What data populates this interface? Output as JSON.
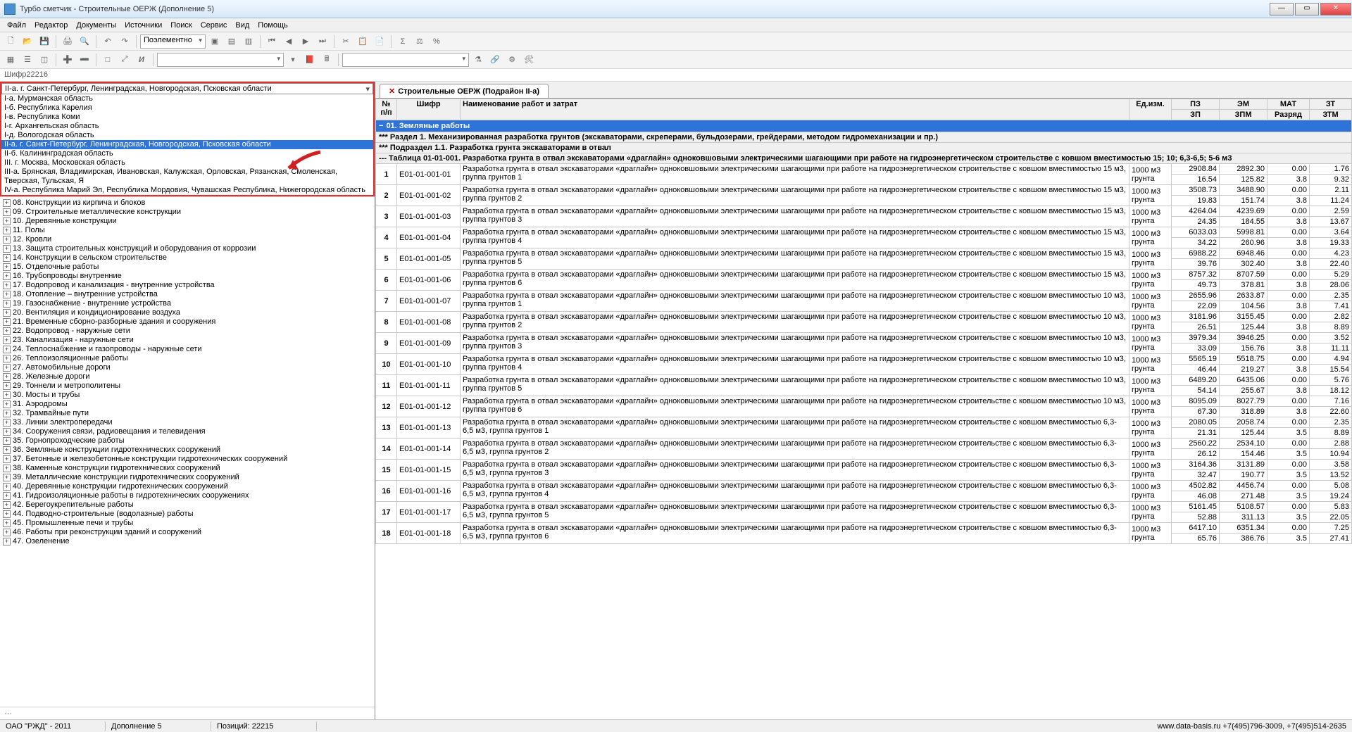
{
  "window": {
    "title": "Турбо сметчик - Строительные ОЕРЖ (Дополнение 5)"
  },
  "menu": [
    "Файл",
    "Редактор",
    "Документы",
    "Источники",
    "Поиск",
    "Сервис",
    "Вид",
    "Помощь"
  ],
  "toolbar2": {
    "combo": "Поэлементно"
  },
  "cipher": "Шифр22216",
  "region": {
    "current": "II-а. г. Санкт-Петербург, Ленинградская, Новгородская, Псковская области",
    "items": [
      "I-а. Мурманская область",
      "I-б. Республика Карелия",
      "I-в. Республика Коми",
      "I-г. Архангельская область",
      "I-д. Вологодская область",
      "II-а. г. Санкт-Петербург, Ленинградская, Новгородская, Псковская области",
      "II-б. Калининградская область",
      "III. г. Москва, Московская область",
      "III-а. Брянская, Владимирская, Ивановская, Калужская, Орловская, Рязанская, Смоленская, Тверская, Тульская, Я",
      "IV-а. Республика Марий Эл, Республика Мордовия, Чувашская Республика, Нижегородская область"
    ],
    "selectedIndex": 5
  },
  "tree": [
    "08. Конструкции из кирпича и блоков",
    "09. Строительные металлические конструкции",
    "10. Деревянные конструкции",
    "11. Полы",
    "12. Кровли",
    "13. Защита строительных конструкций и оборудования от коррозии",
    "14. Конструкции в сельском строительстве",
    "15. Отделочные работы",
    "16. Трубопроводы внутренние",
    "17. Водопровод и канализация - внутренние устройства",
    "18. Отопление – внутренние устройства",
    "19. Газоснабжение - внутренние устройства",
    "20. Вентиляция и кондиционирование воздуха",
    "21. Временные сборно-разборные здания и сооружения",
    "22. Водопровод - наружные сети",
    "23. Канализация - наружные сети",
    "24. Теплоснабжение и газопроводы - наружные сети",
    "26. Теплоизоляционные работы",
    "27. Автомобильные дороги",
    "28. Железные дороги",
    "29. Тоннели и метрополитены",
    "30. Мосты и трубы",
    "31. Аэродромы",
    "32. Трамвайные пути",
    "33. Линии электропередачи",
    "34. Сооружения связи, радиовещания и телевидения",
    "35. Горнопроходческие работы",
    "36. Земляные конструкции гидротехнических сооружений",
    "37. Бетонные и железобетонные конструкции гидротехнических сооружений",
    "38. Каменные конструкции гидротехнических сооружений",
    "39. Металлические конструкции гидротехнических сооружений",
    "40. Деревянные конструкции гидротехнических сооружений",
    "41. Гидроизоляционные работы в гидротехнических сооружениях",
    "42. Берегоукрепительные работы",
    "44. Подводно-строительные (водолазные) работы",
    "45. Промышленные печи и трубы",
    "46. Работы при реконструкции зданий и сооружений",
    "47. Озеленение"
  ],
  "tab": "Строительные ОЕРЖ (Подрайон II-а)",
  "cols": {
    "np": "№ п/п",
    "code": "Шифр",
    "name": "Наименование работ и затрат",
    "unit": "Ед.изм.",
    "pz": "ПЗ",
    "em": "ЭМ",
    "mat": "МАТ",
    "zt": "ЗТ",
    "zp": "ЗП",
    "zpm": "ЗПМ",
    "razr": "Разряд",
    "ztm": "ЗТМ"
  },
  "sections": {
    "s1": "01. Земляные работы",
    "s2": "Раздел 1. Механизированная разработка грунтов (экскаваторами, скреперами, бульдозерами, грейдерами, методом гидромеханизации и пр.)",
    "s3": "Подраздел 1.1. Разработка грунта экскаваторами в отвал",
    "s4": "Таблица 01-01-001. Разработка грунта в отвал экскаваторами «драглайн» одноковшовыми электрическими шагающими при работе на гидроэнергетическом строительстве с ковшом вместимостью 15; 10; 6,3-6,5; 5-6 м3"
  },
  "unit_label": "1000 м3 грунта",
  "rows": [
    {
      "n": "1",
      "code": "Е01-01-001-01",
      "name": "Разработка грунта в отвал экскаваторами «драглайн» одноковшовыми электрическими шагающими при работе на гидроэнергетическом строительстве с ковшом вместимостью 15 м3, группа грунтов 1",
      "r1": [
        "2908.84",
        "2892.30",
        "0.00",
        "1.76"
      ],
      "r2": [
        "16.54",
        "125.82",
        "3.8",
        "9.32"
      ]
    },
    {
      "n": "2",
      "code": "Е01-01-001-02",
      "name": "Разработка грунта в отвал экскаваторами «драглайн» одноковшовыми электрическими шагающими при работе на гидроэнергетическом строительстве с ковшом вместимостью 15 м3, группа грунтов 2",
      "r1": [
        "3508.73",
        "3488.90",
        "0.00",
        "2.11"
      ],
      "r2": [
        "19.83",
        "151.74",
        "3.8",
        "11.24"
      ]
    },
    {
      "n": "3",
      "code": "Е01-01-001-03",
      "name": "Разработка грунта в отвал экскаваторами «драглайн» одноковшовыми электрическими шагающими при работе на гидроэнергетическом строительстве с ковшом вместимостью 15 м3, группа грунтов 3",
      "r1": [
        "4264.04",
        "4239.69",
        "0.00",
        "2.59"
      ],
      "r2": [
        "24.35",
        "184.55",
        "3.8",
        "13.67"
      ]
    },
    {
      "n": "4",
      "code": "Е01-01-001-04",
      "name": "Разработка грунта в отвал экскаваторами «драглайн» одноковшовыми электрическими шагающими при работе на гидроэнергетическом строительстве с ковшом вместимостью 15 м3, группа грунтов 4",
      "r1": [
        "6033.03",
        "5998.81",
        "0.00",
        "3.64"
      ],
      "r2": [
        "34.22",
        "260.96",
        "3.8",
        "19.33"
      ]
    },
    {
      "n": "5",
      "code": "Е01-01-001-05",
      "name": "Разработка грунта в отвал экскаваторами «драглайн» одноковшовыми электрическими шагающими при работе на гидроэнергетическом строительстве с ковшом вместимостью 15 м3, группа грунтов 5",
      "r1": [
        "6988.22",
        "6948.46",
        "0.00",
        "4.23"
      ],
      "r2": [
        "39.76",
        "302.40",
        "3.8",
        "22.40"
      ]
    },
    {
      "n": "6",
      "code": "Е01-01-001-06",
      "name": "Разработка грунта в отвал экскаваторами «драглайн» одноковшовыми электрическими шагающими при работе на гидроэнергетическом строительстве с ковшом вместимостью 15 м3, группа грунтов 6",
      "r1": [
        "8757.32",
        "8707.59",
        "0.00",
        "5.29"
      ],
      "r2": [
        "49.73",
        "378.81",
        "3.8",
        "28.06"
      ]
    },
    {
      "n": "7",
      "code": "Е01-01-001-07",
      "name": "Разработка грунта в отвал экскаваторами «драглайн» одноковшовыми электрическими шагающими при работе на гидроэнергетическом строительстве с ковшом вместимостью 10 м3, группа грунтов 1",
      "r1": [
        "2655.96",
        "2633.87",
        "0.00",
        "2.35"
      ],
      "r2": [
        "22.09",
        "104.56",
        "3.8",
        "7.41"
      ]
    },
    {
      "n": "8",
      "code": "Е01-01-001-08",
      "name": "Разработка грунта в отвал экскаваторами «драглайн» одноковшовыми электрическими шагающими при работе на гидроэнергетическом строительстве с ковшом вместимостью 10 м3, группа грунтов 2",
      "r1": [
        "3181.96",
        "3155.45",
        "0.00",
        "2.82"
      ],
      "r2": [
        "26.51",
        "125.44",
        "3.8",
        "8.89"
      ]
    },
    {
      "n": "9",
      "code": "Е01-01-001-09",
      "name": "Разработка грунта в отвал экскаваторами «драглайн» одноковшовыми электрическими шагающими при работе на гидроэнергетическом строительстве с ковшом вместимостью 10 м3, группа грунтов 3",
      "r1": [
        "3979.34",
        "3946.25",
        "0.00",
        "3.52"
      ],
      "r2": [
        "33.09",
        "156.76",
        "3.8",
        "11.11"
      ]
    },
    {
      "n": "10",
      "code": "Е01-01-001-10",
      "name": "Разработка грунта в отвал экскаваторами «драглайн» одноковшовыми электрическими шагающими при работе на гидроэнергетическом строительстве с ковшом вместимостью 10 м3, группа грунтов 4",
      "r1": [
        "5565.19",
        "5518.75",
        "0.00",
        "4.94"
      ],
      "r2": [
        "46.44",
        "219.27",
        "3.8",
        "15.54"
      ]
    },
    {
      "n": "11",
      "code": "Е01-01-001-11",
      "name": "Разработка грунта в отвал экскаваторами «драглайн» одноковшовыми электрическими шагающими при работе на гидроэнергетическом строительстве с ковшом вместимостью 10 м3, группа грунтов 5",
      "r1": [
        "6489.20",
        "6435.06",
        "0.00",
        "5.76"
      ],
      "r2": [
        "54.14",
        "255.67",
        "3.8",
        "18.12"
      ]
    },
    {
      "n": "12",
      "code": "Е01-01-001-12",
      "name": "Разработка грунта в отвал экскаваторами «драглайн» одноковшовыми электрическими шагающими при работе на гидроэнергетическом строительстве с ковшом вместимостью 10 м3, группа грунтов 6",
      "r1": [
        "8095.09",
        "8027.79",
        "0.00",
        "7.16"
      ],
      "r2": [
        "67.30",
        "318.89",
        "3.8",
        "22.60"
      ]
    },
    {
      "n": "13",
      "code": "Е01-01-001-13",
      "name": "Разработка грунта в отвал экскаваторами «драглайн» одноковшовыми электрическими шагающими при работе на гидроэнергетическом строительстве с ковшом вместимостью 6,3-6,5 м3, группа грунтов 1",
      "r1": [
        "2080.05",
        "2058.74",
        "0.00",
        "2.35"
      ],
      "r2": [
        "21.31",
        "125.44",
        "3.5",
        "8.89"
      ]
    },
    {
      "n": "14",
      "code": "Е01-01-001-14",
      "name": "Разработка грунта в отвал экскаваторами «драглайн» одноковшовыми электрическими шагающими при работе на гидроэнергетическом строительстве с ковшом вместимостью 6,3-6,5 м3, группа грунтов 2",
      "r1": [
        "2560.22",
        "2534.10",
        "0.00",
        "2.88"
      ],
      "r2": [
        "26.12",
        "154.46",
        "3.5",
        "10.94"
      ]
    },
    {
      "n": "15",
      "code": "Е01-01-001-15",
      "name": "Разработка грунта в отвал экскаваторами «драглайн» одноковшовыми электрическими шагающими при работе на гидроэнергетическом строительстве с ковшом вместимостью 6,3-6,5 м3, группа грунтов 3",
      "r1": [
        "3164.36",
        "3131.89",
        "0.00",
        "3.58"
      ],
      "r2": [
        "32.47",
        "190.77",
        "3.5",
        "13.52"
      ]
    },
    {
      "n": "16",
      "code": "Е01-01-001-16",
      "name": "Разработка грунта в отвал экскаваторами «драглайн» одноковшовыми электрическими шагающими при работе на гидроэнергетическом строительстве с ковшом вместимостью 6,3-6,5 м3, группа грунтов 4",
      "r1": [
        "4502.82",
        "4456.74",
        "0.00",
        "5.08"
      ],
      "r2": [
        "46.08",
        "271.48",
        "3.5",
        "19.24"
      ]
    },
    {
      "n": "17",
      "code": "Е01-01-001-17",
      "name": "Разработка грунта в отвал экскаваторами «драглайн» одноковшовыми электрическими шагающими при работе на гидроэнергетическом строительстве с ковшом вместимостью 6,3-6,5 м3, группа грунтов 5",
      "r1": [
        "5161.45",
        "5108.57",
        "0.00",
        "5.83"
      ],
      "r2": [
        "52.88",
        "311.13",
        "3.5",
        "22.05"
      ]
    },
    {
      "n": "18",
      "code": "Е01-01-001-18",
      "name": "Разработка грунта в отвал экскаваторами «драглайн» одноковшовыми электрическими шагающими при работе на гидроэнергетическом строительстве с ковшом вместимостью 6,3-6,5 м3, группа грунтов 6",
      "r1": [
        "6417.10",
        "6351.34",
        "0.00",
        "7.25"
      ],
      "r2": [
        "65.76",
        "386.76",
        "3.5",
        "27.41"
      ]
    }
  ],
  "status": {
    "c1": "ОАО \"РЖД\" - 2011",
    "c2": "Дополнение 5",
    "c3": "Позиций: 22215",
    "right": "www.data-basis.ru  +7(495)796-3009, +7(495)514-2635"
  }
}
